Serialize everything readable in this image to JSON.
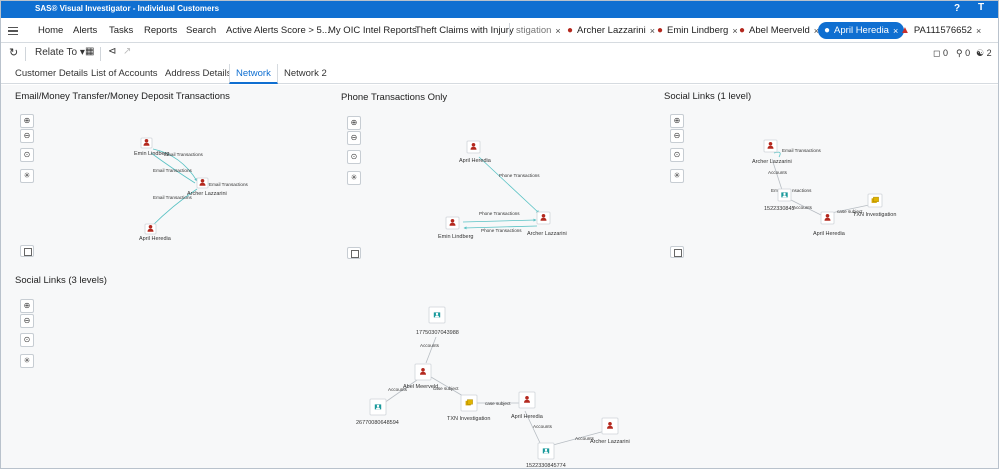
{
  "app": {
    "title": "SAS® Visual Investigator - Individual Customers",
    "help": "?",
    "user": "T"
  },
  "nav": {
    "items": [
      "Home",
      "Alerts",
      "Tasks",
      "Reports",
      "Search",
      "Active Alerts Score > 5...",
      "My OIC Intel Reports",
      "Theft Claims with Injury"
    ],
    "doc_tabs": [
      {
        "label": "stigation",
        "close": "×"
      },
      {
        "label": "Archer Lazzarini",
        "close": "×"
      },
      {
        "label": "Emin Lindberg",
        "close": "×"
      },
      {
        "label": "Abel Meerveld",
        "close": "×"
      },
      {
        "label": "April Heredia",
        "close": "×"
      },
      {
        "label": "PA111576652",
        "close": "×"
      }
    ]
  },
  "toolbar": {
    "relate_to": "Relate To",
    "comments_count": "0",
    "attachments_count": "0",
    "links_count": "2"
  },
  "tabs": [
    "Customer Details",
    "List of Accounts",
    "Address Details",
    "Network",
    "Network 2"
  ],
  "panels": {
    "p1": {
      "title": "Email/Money Transfer/Money Deposit Transactions",
      "nodes": [
        "Emin Lindberg",
        "Archer Lazzarini",
        "April Heredia"
      ],
      "edges": [
        "Email Transactions",
        "Email Transactions",
        "Email Transactions",
        "Email Transactions"
      ]
    },
    "p2": {
      "title": "Phone Transactions Only",
      "nodes": [
        "April Heredia",
        "Emin Lindberg",
        "Archer Lazzarini"
      ],
      "edges": [
        "Phone Transactions",
        "Phone Transactions",
        "Phone Transactions"
      ]
    },
    "p3": {
      "title": "Social Links (1 level)",
      "nodes": [
        "Archer Lazzarini",
        "1522330845",
        "April Heredia",
        "TXN Investigation"
      ],
      "edges": [
        "Email Transactions",
        "Accounts",
        "Em",
        "nsactions",
        "Accounts",
        "case subject"
      ]
    },
    "p4": {
      "title": "Social Links (3 levels)",
      "nodes": [
        "17750307043988",
        "Abel Meerveld",
        "26770080648594",
        "TXN Investigation",
        "April Heredia",
        "Archer Lazzarini",
        "1522330845774"
      ],
      "edges": [
        "Accounts",
        "Accounts",
        "case subject",
        "case subject",
        "Accounts",
        "Accounts"
      ]
    }
  },
  "colors": {
    "brand": "#0f6fd1",
    "person": "#b4281e",
    "account": "#1a9a9c",
    "case": "#d4a500",
    "edge": "#59c2c4"
  }
}
